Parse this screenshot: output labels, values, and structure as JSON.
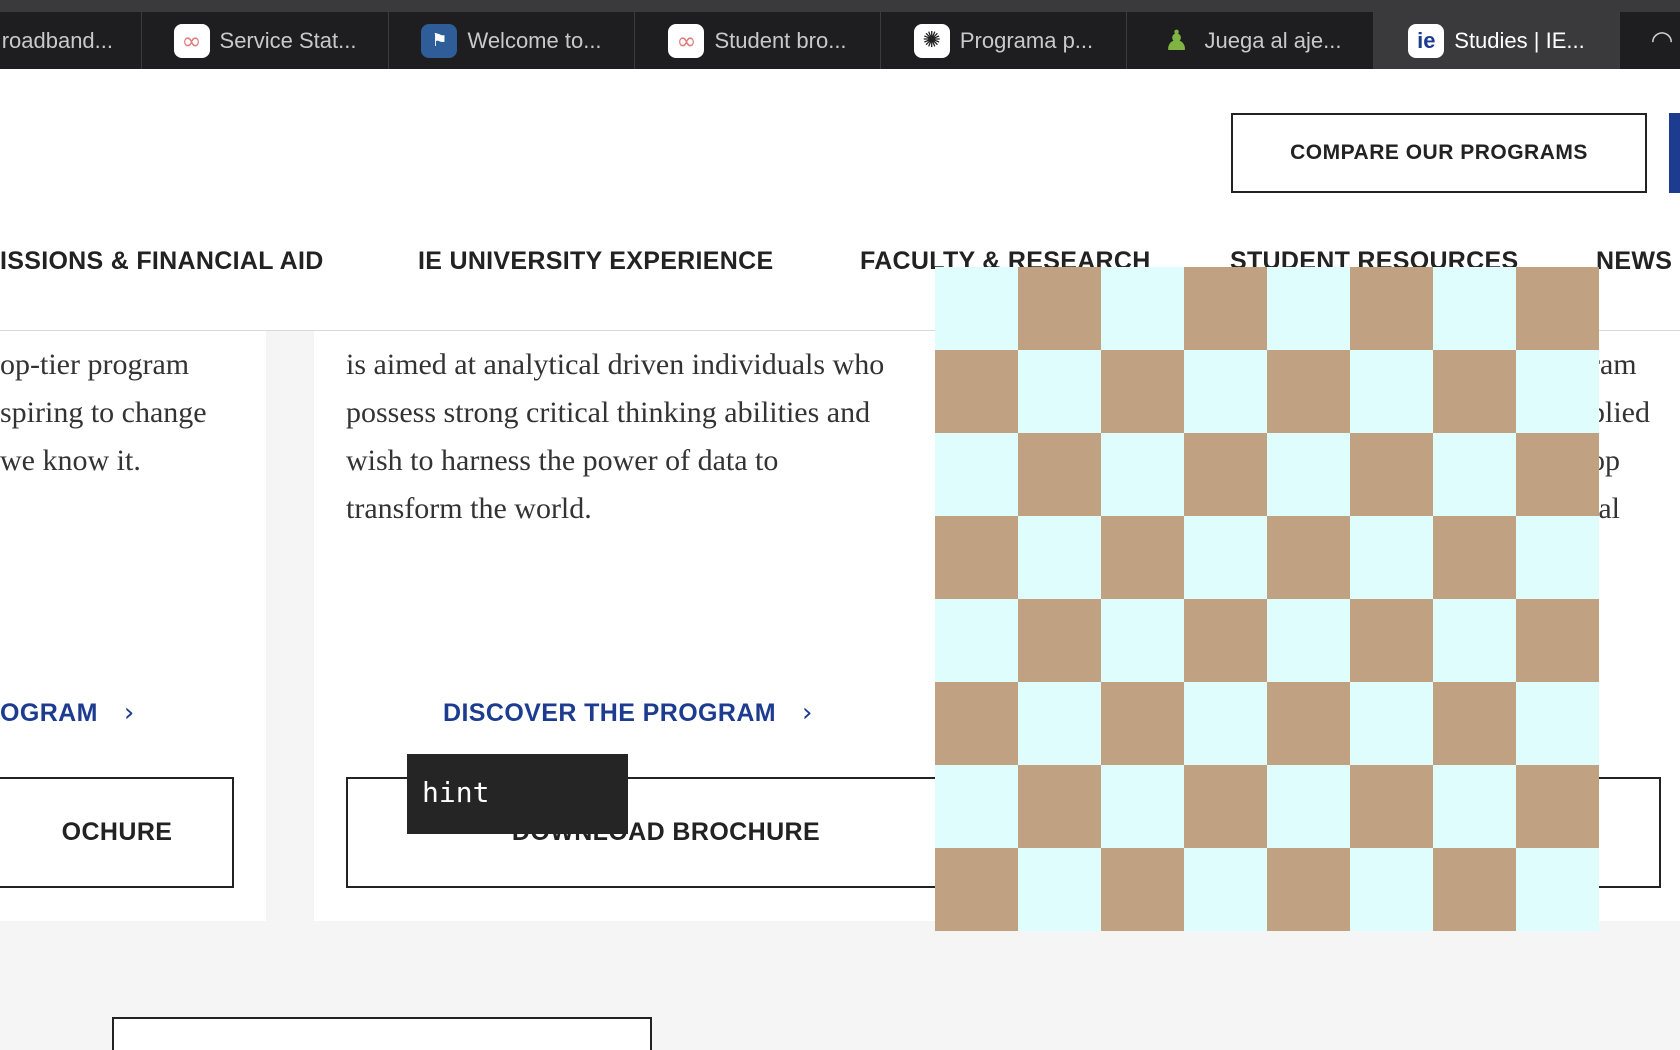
{
  "tabs": [
    {
      "label": "roadband...",
      "icon": "partial-icon",
      "active": false
    },
    {
      "label": "Service Stat...",
      "icon": "infinity-icon",
      "active": false
    },
    {
      "label": "Welcome to...",
      "icon": "flag-icon",
      "active": false
    },
    {
      "label": "Student bro...",
      "icon": "infinity-icon",
      "active": false
    },
    {
      "label": "Programa p...",
      "icon": "openai-icon",
      "active": false
    },
    {
      "label": "Juega al aje...",
      "icon": "pawn-icon",
      "active": false
    },
    {
      "label": "Studies | IE...",
      "icon": "ie-icon",
      "active": true
    }
  ],
  "favicon_glyphs": {
    "infinity": "∞",
    "flag": "⚑",
    "openai": "✺",
    "pawn": "♟",
    "ie": "ie",
    "edge": "◠"
  },
  "header": {
    "compare_label": "COMPARE OUR PROGRAMS"
  },
  "nav": {
    "items": [
      "ISSIONS & FINANCIAL AID",
      "IE UNIVERSITY EXPERIENCE",
      "FACULTY & RESEARCH",
      "STUDENT RESOURCES",
      "NEWS"
    ]
  },
  "cards": {
    "left": {
      "lines": [
        "op-tier program",
        "spiring to change",
        "we know it."
      ],
      "discover_label": "OGRAM",
      "brochure_label": "OCHURE"
    },
    "middle": {
      "lines": [
        "is aimed at analytical driven individuals who",
        "possess strong critical thinking abilities and",
        "wish to harness the power of data to",
        "transform the world."
      ],
      "discover_label": "DISCOVER THE PROGRAM",
      "brochure_label": "DOWNLOAD BROCHURE"
    },
    "right": {
      "lines": [
        "ram",
        "plied",
        "op",
        "tal"
      ]
    }
  },
  "hint": {
    "text": "hint"
  },
  "board": {
    "rows": 8,
    "cols": 8,
    "dark_color": "#c0a283",
    "light_color": "#e0fdfd"
  },
  "colors": {
    "accent": "#1d3c8f",
    "tab_bg": "#1e1e20",
    "tab_active": "#3a3a3d"
  }
}
